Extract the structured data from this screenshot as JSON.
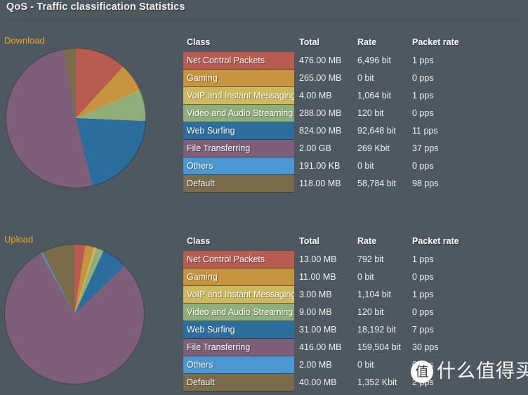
{
  "header": {
    "title": "QoS - Traffic classification Statistics"
  },
  "colors": {
    "background": "#4d5860",
    "accent_label": "#e8a81e",
    "text": "#f0f0f0",
    "net_control_packets": "#b85c52",
    "gaming": "#c6933f",
    "voip_and_instant_messaging": "#ccb85f",
    "video_and_audio_streaming": "#8fae79",
    "web_surfing": "#2b6e9e",
    "file_transferring": "#7d5f7a",
    "others": "#4a97d2",
    "default": "#7a6b4a"
  },
  "table_columns": [
    "Class",
    "Total",
    "Rate",
    "Packet rate"
  ],
  "sections": [
    {
      "id": "download",
      "label": "Download",
      "rows": [
        {
          "class": "Net Control Packets",
          "color": "#b85c52",
          "total": "476.00 MB",
          "rate": "6,496 bit",
          "packet_rate": "1 pps"
        },
        {
          "class": "Gaming",
          "color": "#c6933f",
          "total": "265.00 MB",
          "rate": "0 bit",
          "packet_rate": "0 pps"
        },
        {
          "class": "VoIP and Instant Messaging",
          "color": "#ccb85f",
          "total": "4.00 MB",
          "rate": "1,064 bit",
          "packet_rate": "1 pps"
        },
        {
          "class": "Video and Audio Streaming",
          "color": "#8fae79",
          "total": "288.00 MB",
          "rate": "120 bit",
          "packet_rate": "0 pps"
        },
        {
          "class": "Web Surfing",
          "color": "#2b6e9e",
          "total": "824.00 MB",
          "rate": "92,648 bit",
          "packet_rate": "11 pps"
        },
        {
          "class": "File Transferring",
          "color": "#7d5f7a",
          "total": "2.00 GB",
          "rate": "269 Kbit",
          "packet_rate": "37 pps"
        },
        {
          "class": "Others",
          "color": "#4a97d2",
          "total": "191.00 KB",
          "rate": "0 bit",
          "packet_rate": "0 pps"
        },
        {
          "class": "Default",
          "color": "#7a6b4a",
          "total": "118.00 MB",
          "rate": "58,784 bit",
          "packet_rate": "98 pps"
        }
      ]
    },
    {
      "id": "upload",
      "label": "Upload",
      "rows": [
        {
          "class": "Net Control Packets",
          "color": "#b85c52",
          "total": "13.00 MB",
          "rate": "792 bit",
          "packet_rate": "1 pps"
        },
        {
          "class": "Gaming",
          "color": "#c6933f",
          "total": "11.00 MB",
          "rate": "0 bit",
          "packet_rate": "0 pps"
        },
        {
          "class": "VoIP and Instant Messaging",
          "color": "#ccb85f",
          "total": "3.00 MB",
          "rate": "1,104 bit",
          "packet_rate": "1 pps"
        },
        {
          "class": "Video and Audio Streaming",
          "color": "#8fae79",
          "total": "9.00 MB",
          "rate": "120 bit",
          "packet_rate": "0 pps"
        },
        {
          "class": "Web Surfing",
          "color": "#2b6e9e",
          "total": "31.00 MB",
          "rate": "18,192 bit",
          "packet_rate": "7 pps"
        },
        {
          "class": "File Transferring",
          "color": "#7d5f7a",
          "total": "416.00 MB",
          "rate": "159,504 bit",
          "packet_rate": "30 pps"
        },
        {
          "class": "Others",
          "color": "#4a97d2",
          "total": "2.00 MB",
          "rate": "0 bit",
          "packet_rate": "0 pps"
        },
        {
          "class": "Default",
          "color": "#7a6b4a",
          "total": "40.00 MB",
          "rate": "1,352 Kbit",
          "packet_rate": "2 pps"
        }
      ]
    }
  ],
  "chart_data": [
    {
      "type": "pie",
      "title": "Download",
      "labels": [
        "Net Control Packets",
        "Gaming",
        "VoIP and Instant Messaging",
        "Video and Audio Streaming",
        "Web Surfing",
        "File Transferring",
        "Others",
        "Default"
      ],
      "values": [
        476,
        265,
        4,
        288,
        824,
        2048,
        0.19,
        118
      ],
      "value_unit": "MB",
      "display_values": [
        "476.00 MB",
        "265.00 MB",
        "4.00 MB",
        "288.00 MB",
        "824.00 MB",
        "2.00 GB",
        "191.00 KB",
        "118.00 MB"
      ],
      "colors": [
        "#b85c52",
        "#c6933f",
        "#ccb85f",
        "#8fae79",
        "#2b6e9e",
        "#7d5f7a",
        "#4a97d2",
        "#7a6b4a"
      ],
      "start_angle_deg": 0,
      "direction": "clockwise",
      "legend": "table"
    },
    {
      "type": "pie",
      "title": "Upload",
      "labels": [
        "Net Control Packets",
        "Gaming",
        "VoIP and Instant Messaging",
        "Video and Audio Streaming",
        "Web Surfing",
        "File Transferring",
        "Others",
        "Default"
      ],
      "values": [
        13,
        11,
        3,
        9,
        31,
        416,
        2,
        40
      ],
      "value_unit": "MB",
      "display_values": [
        "13.00 MB",
        "11.00 MB",
        "3.00 MB",
        "9.00 MB",
        "31.00 MB",
        "416.00 MB",
        "2.00 MB",
        "40.00 MB"
      ],
      "colors": [
        "#b85c52",
        "#c6933f",
        "#ccb85f",
        "#8fae79",
        "#2b6e9e",
        "#7d5f7a",
        "#4a97d2",
        "#7a6b4a"
      ],
      "start_angle_deg": 0,
      "direction": "clockwise",
      "legend": "table"
    }
  ],
  "watermark": {
    "badge": "值",
    "text": "什么值得买"
  }
}
